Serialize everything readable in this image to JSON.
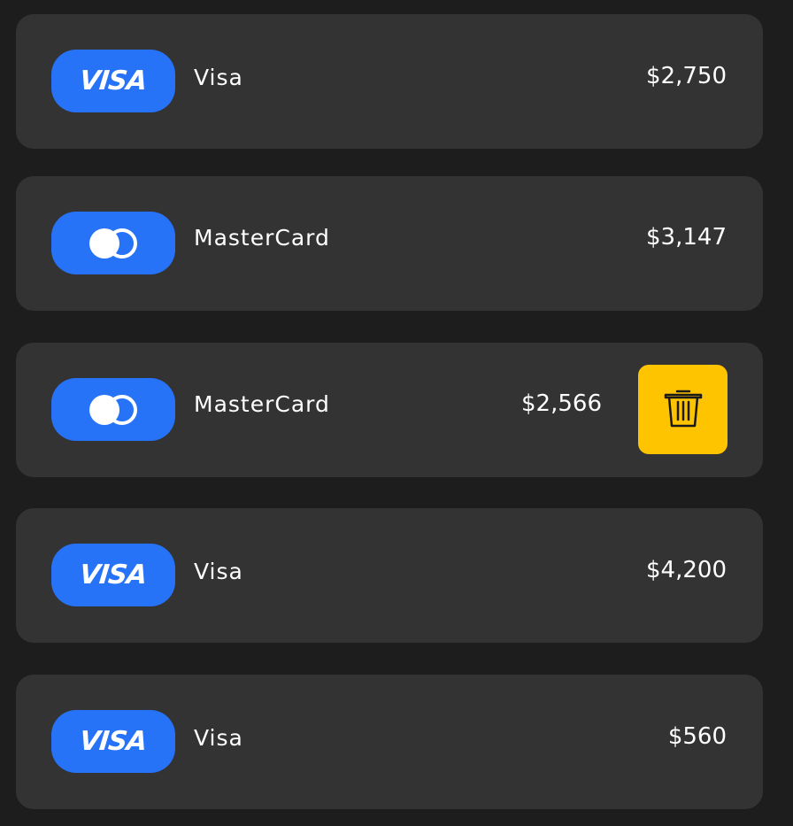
{
  "cards": [
    {
      "brand": "visa",
      "badge_label": "VISA",
      "name": "Visa",
      "amount": "$2,750"
    },
    {
      "brand": "mastercard",
      "name": "MasterCard",
      "amount": "$3,147"
    },
    {
      "brand": "mastercard",
      "name": "MasterCard",
      "amount": "$2,566",
      "delete_icon": "trash-icon"
    },
    {
      "brand": "visa",
      "badge_label": "VISA",
      "name": "Visa",
      "amount": "$4,200"
    },
    {
      "brand": "visa",
      "badge_label": "VISA",
      "name": "Visa",
      "amount": "$560"
    }
  ],
  "colors": {
    "background": "#1d1d1d",
    "card": "#333333",
    "badge": "#2673f8",
    "delete": "#ffc400",
    "text": "#ffffff"
  }
}
